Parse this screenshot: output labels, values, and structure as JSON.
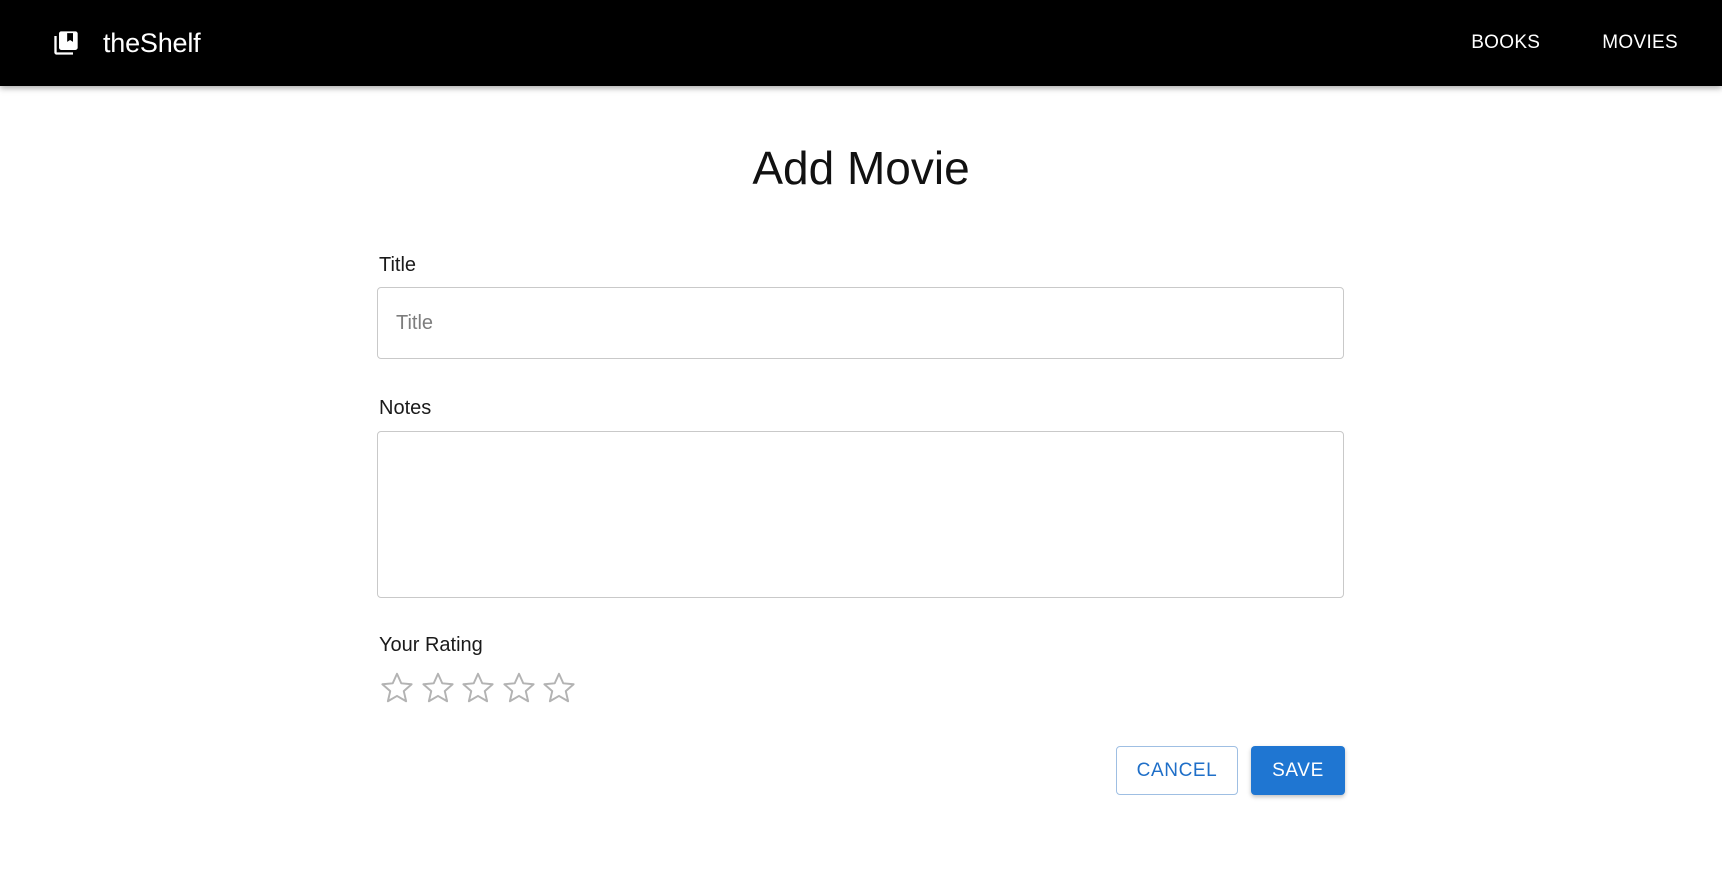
{
  "app": {
    "brand_name": "theShelf",
    "brand_icon": "library-books-icon"
  },
  "nav": {
    "books_label": "BOOKS",
    "movies_label": "MOVIES"
  },
  "page": {
    "title": "Add Movie"
  },
  "form": {
    "title_label": "Title",
    "title_placeholder": "Title",
    "title_value": "",
    "notes_label": "Notes",
    "notes_value": "",
    "rating_label": "Your Rating",
    "rating_value": 0,
    "rating_max": 5,
    "star_icon": "star-outline-icon"
  },
  "actions": {
    "cancel_label": "CANCEL",
    "save_label": "SAVE"
  },
  "colors": {
    "app_bar": "#000000",
    "primary": "#1f76d2",
    "star_outline": "#b3b3b3"
  }
}
